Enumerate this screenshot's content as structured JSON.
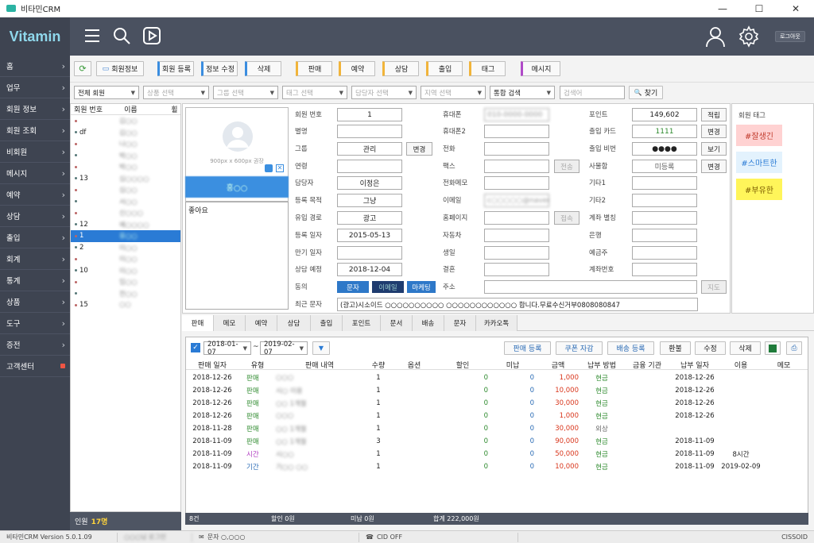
{
  "window": {
    "title": "비타민CRM",
    "min": "—",
    "max": "☐",
    "close": "✕"
  },
  "header": {
    "logo": "Vitamin",
    "logout": "로그아웃"
  },
  "sidebar": {
    "items": [
      {
        "label": "홈",
        "chev": "›"
      },
      {
        "label": "업무",
        "chev": "›"
      },
      {
        "label": "회원 정보",
        "chev": "›"
      },
      {
        "label": "회원 조회",
        "chev": "›"
      },
      {
        "label": "비회원",
        "chev": "›"
      },
      {
        "label": "메시지",
        "chev": "›"
      },
      {
        "label": "예약",
        "chev": "›"
      },
      {
        "label": "상담",
        "chev": "›"
      },
      {
        "label": "출입",
        "chev": "›"
      },
      {
        "label": "회계",
        "chev": "›"
      },
      {
        "label": "통계",
        "chev": "›"
      },
      {
        "label": "상품",
        "chev": "›"
      },
      {
        "label": "도구",
        "chev": "›"
      },
      {
        "label": "증전",
        "chev": "›"
      },
      {
        "label": "고객센터",
        "chev": ""
      }
    ]
  },
  "toolbar": {
    "member_info": "회원정보",
    "register": "회원 등록",
    "edit_info": "정보 수정",
    "delete": "삭제",
    "sale": "판매",
    "reserve": "예약",
    "consult": "상담",
    "attend": "출입",
    "tag": "태그",
    "message": "메시지"
  },
  "filter": {
    "member_type": "전체 회원",
    "product": "상품 선택",
    "group": "그룹 선택",
    "tag": "태그 선택",
    "staff": "담당자 선택",
    "region": "지역 선택",
    "search_type": "통합 검색",
    "search_placeholder": "검색어",
    "find": "찾기"
  },
  "member_list": {
    "col_num": "회원 번호",
    "col_name": "이름",
    "col_extra": "휠",
    "rows": [
      {
        "num": "",
        "name": "김○○"
      },
      {
        "num": "df",
        "name": "김○○"
      },
      {
        "num": "",
        "name": "나○○"
      },
      {
        "num": "",
        "name": "박○○"
      },
      {
        "num": "",
        "name": "박○○"
      },
      {
        "num": "13",
        "name": "심○○○○"
      },
      {
        "num": "",
        "name": "심○○"
      },
      {
        "num": "",
        "name": "서○○"
      },
      {
        "num": "",
        "name": "신○○○"
      },
      {
        "num": "12",
        "name": "예○○○○"
      },
      {
        "num": "1",
        "name": "유○○"
      },
      {
        "num": "2",
        "name": "이○○"
      },
      {
        "num": "",
        "name": "이○○"
      },
      {
        "num": "10",
        "name": "이○○"
      },
      {
        "num": "",
        "name": "임○○"
      },
      {
        "num": "",
        "name": "전○○"
      },
      {
        "num": "15",
        "name": "○○"
      }
    ],
    "count_label": "인원",
    "count": "17명"
  },
  "photo": {
    "caption": "900px x 600px 권장",
    "name": "홍○○"
  },
  "memo": "좋아요",
  "detail": {
    "member_no_label": "회원 번호",
    "member_no": "1",
    "nickname_label": "별명",
    "nickname": "",
    "group_label": "그룹",
    "group": "관리",
    "group_change": "변경",
    "contact_label": "연령",
    "contact": "",
    "manager_label": "담당자",
    "manager": "이정은",
    "purpose_label": "등록 목적",
    "purpose": "그냥",
    "inflow_label": "유입 경로",
    "inflow": "광고",
    "regdate_label": "등록 일자",
    "regdate": "2015-05-13",
    "expire_label": "만기 일자",
    "expire": "",
    "consult_label": "상담 예정",
    "consult": "2018-12-04",
    "agree_label": "동의",
    "agree_sms": "문자",
    "agree_email": "이메일",
    "agree_mkt": "마케팅",
    "recent_label": "최근 문자",
    "recent": "(광고)시소이드 ○○○○○○○○○○ ○○○○○○○○○○○○ 합니다.무료수신거부0808080847",
    "mobile_label": "휴대폰",
    "mobile": "010-0000-0000",
    "mobile2_label": "휴대폰2",
    "mobile2": "",
    "phone_label": "전화",
    "phone": "",
    "fax_label": "팩스",
    "fax": "",
    "send": "전송",
    "phonememo_label": "전화메모",
    "phonememo": "",
    "email_label": "이메일",
    "email": "c○○○○○@naver.com",
    "homepage_label": "홈페이지",
    "homepage": "",
    "connect": "접속",
    "car_label": "자동차",
    "car": "",
    "birth_label": "생일",
    "birth": "",
    "wedding_label": "결혼",
    "wedding": "",
    "address_label": "주소",
    "address": "",
    "map": "지도",
    "point_label": "포인트",
    "point": "149,602",
    "accumulate": "적립",
    "card_label": "출입 카드",
    "card": "1111",
    "card_change": "변경",
    "pin_label": "출입 비번",
    "pin": "●●●●",
    "pin_view": "보기",
    "locker_label": "사물함",
    "locker": "미등록",
    "locker_change": "변경",
    "etc1_label": "기타1",
    "etc1": "",
    "etc2_label": "기타2",
    "etc2": "",
    "alias_label": "계좌 별칭",
    "alias": "",
    "bank_label": "은행",
    "bank": "",
    "holder_label": "예금주",
    "holder": "",
    "account_label": "계좌번호",
    "account": ""
  },
  "tags": {
    "title": "회원 태그",
    "items": [
      {
        "label": "#잘생긴"
      },
      {
        "label": "#스마트한"
      },
      {
        "label": "#부유한"
      }
    ]
  },
  "tabs": [
    "판매",
    "메모",
    "예약",
    "상담",
    "출입",
    "포인트",
    "문서",
    "배송",
    "문자",
    "카카오톡"
  ],
  "sales": {
    "date_from": "2018-01-07",
    "date_to": "2019-02-07",
    "tilde": "~",
    "btn_sale": "판매 등록",
    "btn_coupon": "쿠폰 자감",
    "btn_ship": "배송 등록",
    "btn_refund": "환불",
    "btn_edit": "수정",
    "btn_delete": "삭제",
    "headers": [
      "판매 일자",
      "유형",
      "판매 내역",
      "수량",
      "옵션",
      "할인",
      "미납",
      "금액",
      "납부 방법",
      "금융 기관",
      "납부 일자",
      "이용",
      "메모"
    ],
    "rows": [
      {
        "date": "2018-12-26",
        "type": "판매",
        "item": "○○○",
        "qty": "1",
        "opt": "",
        "disc": "0",
        "unpaid": "0",
        "amount": "1,000",
        "method": "현금",
        "bank": "",
        "paydate": "2018-12-26",
        "use": "",
        "memo": ""
      },
      {
        "date": "2018-12-26",
        "type": "판매",
        "item": "시○ 이용",
        "qty": "1",
        "opt": "",
        "disc": "0",
        "unpaid": "0",
        "amount": "10,000",
        "method": "현금",
        "bank": "",
        "paydate": "2018-12-26",
        "use": "",
        "memo": ""
      },
      {
        "date": "2018-12-26",
        "type": "판매",
        "item": "○○ 1개월",
        "qty": "1",
        "opt": "",
        "disc": "0",
        "unpaid": "0",
        "amount": "30,000",
        "method": "현금",
        "bank": "",
        "paydate": "2018-12-26",
        "use": "",
        "memo": ""
      },
      {
        "date": "2018-12-26",
        "type": "판매",
        "item": "○○○",
        "qty": "1",
        "opt": "",
        "disc": "0",
        "unpaid": "0",
        "amount": "1,000",
        "method": "현금",
        "bank": "",
        "paydate": "2018-12-26",
        "use": "",
        "memo": ""
      },
      {
        "date": "2018-11-28",
        "type": "판매",
        "item": "○○ 1개월",
        "qty": "1",
        "opt": "",
        "disc": "0",
        "unpaid": "0",
        "amount": "30,000",
        "method": "외상",
        "bank": "",
        "paydate": "",
        "use": "",
        "memo": ""
      },
      {
        "date": "2018-11-09",
        "type": "판매",
        "item": "○○ 1개월",
        "qty": "3",
        "opt": "",
        "disc": "0",
        "unpaid": "0",
        "amount": "90,000",
        "method": "현금",
        "bank": "",
        "paydate": "2018-11-09",
        "use": "",
        "memo": ""
      },
      {
        "date": "2018-11-09",
        "type": "시간",
        "item": "시○○",
        "qty": "1",
        "opt": "",
        "disc": "0",
        "unpaid": "0",
        "amount": "50,000",
        "method": "현금",
        "bank": "",
        "paydate": "2018-11-09",
        "use": "8시간",
        "memo": ""
      },
      {
        "date": "2018-11-09",
        "type": "기간",
        "item": "기○○ ○○",
        "qty": "1",
        "opt": "",
        "disc": "0",
        "unpaid": "0",
        "amount": "10,000",
        "method": "현금",
        "bank": "",
        "paydate": "2018-11-09",
        "use": "2019-02-09",
        "memo": ""
      }
    ],
    "foot_count": "8건",
    "foot_disc": "할인 0원",
    "foot_unpaid": "미납 0원",
    "foot_total": "합계 222,000원"
  },
  "status": {
    "version": "비타민CRM Version 5.0.1.09",
    "login": "○○○님 로그인",
    "sms": "문자 ○,○○○",
    "cid": "CID OFF",
    "company": "CISSOID"
  },
  "colors": {
    "sidebar": "#3e4451",
    "topbar": "#4a5160",
    "accent": "#2a7bd5",
    "logo": "#8fd8ec",
    "tag1": "#ffd2d2",
    "tag2": "#e3f2fd",
    "tag3": "#fff55a"
  }
}
